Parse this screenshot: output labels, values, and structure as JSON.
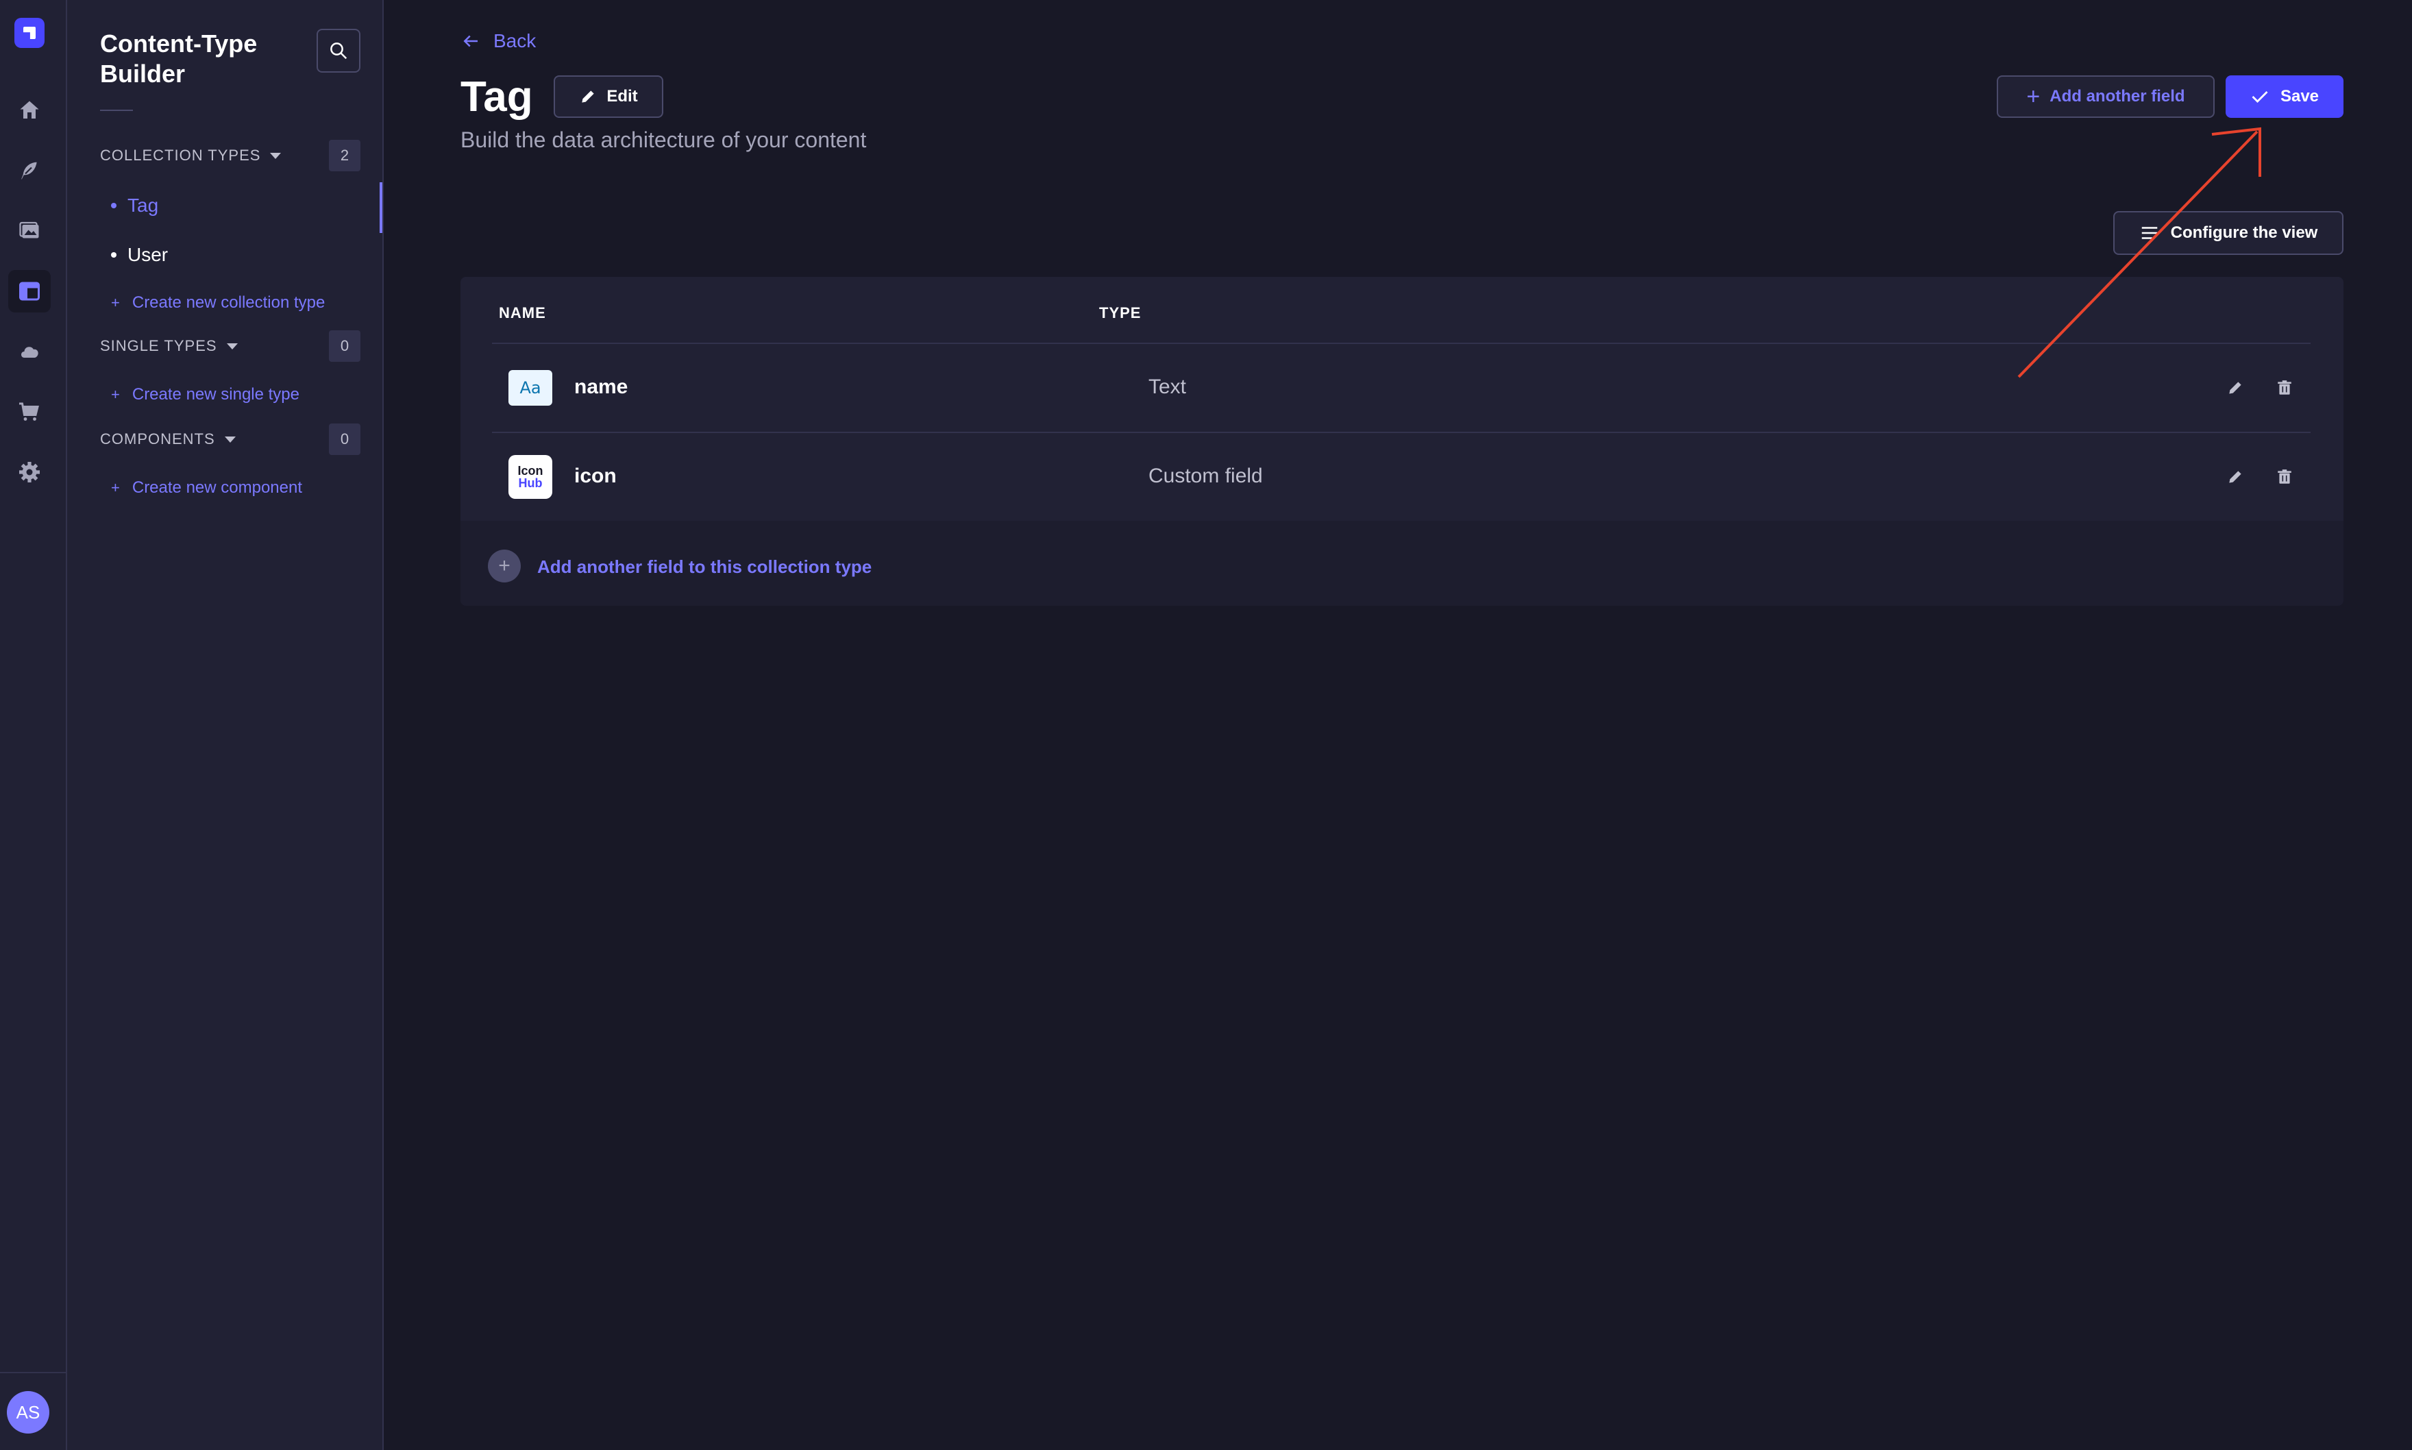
{
  "rail": {
    "items": [
      {
        "icon": "home-icon"
      },
      {
        "icon": "feather-icon"
      },
      {
        "icon": "media-library-icon"
      },
      {
        "icon": "content-type-builder-icon",
        "active": true
      },
      {
        "icon": "cloud-icon"
      },
      {
        "icon": "cart-icon"
      },
      {
        "icon": "gear-icon"
      }
    ],
    "avatar_initials": "AS"
  },
  "subnav": {
    "title": "Content-Type Builder",
    "search_icon": "search-icon",
    "collection_types": {
      "label": "COLLECTION TYPES",
      "count": "2",
      "items": [
        {
          "label": "Tag",
          "active": true
        },
        {
          "label": "User",
          "active": false
        }
      ],
      "create_label": "Create new collection type"
    },
    "single_types": {
      "label": "SINGLE TYPES",
      "count": "0",
      "create_label": "Create new single type"
    },
    "components": {
      "label": "COMPONENTS",
      "count": "0",
      "create_label": "Create new component"
    }
  },
  "header": {
    "back_label": "Back",
    "title": "Tag",
    "edit_label": "Edit",
    "subtitle": "Build the data architecture of your content",
    "add_field_label": "Add another field",
    "save_label": "Save",
    "configure_label": "Configure the view"
  },
  "table": {
    "columns": [
      "NAME",
      "TYPE"
    ],
    "rows": [
      {
        "icon_text": "Aa",
        "name": "name",
        "type": "Text"
      },
      {
        "icon_text_top": "Icon",
        "icon_text_bottom": "Hub",
        "name": "icon",
        "type": "Custom field"
      }
    ],
    "footer_label": "Add another field to this collection type"
  },
  "colors": {
    "accent": "#4945ff",
    "accent_light": "#7b79ff",
    "background": "#181826",
    "panel": "#212134",
    "annotation_arrow": "#e8432d"
  }
}
